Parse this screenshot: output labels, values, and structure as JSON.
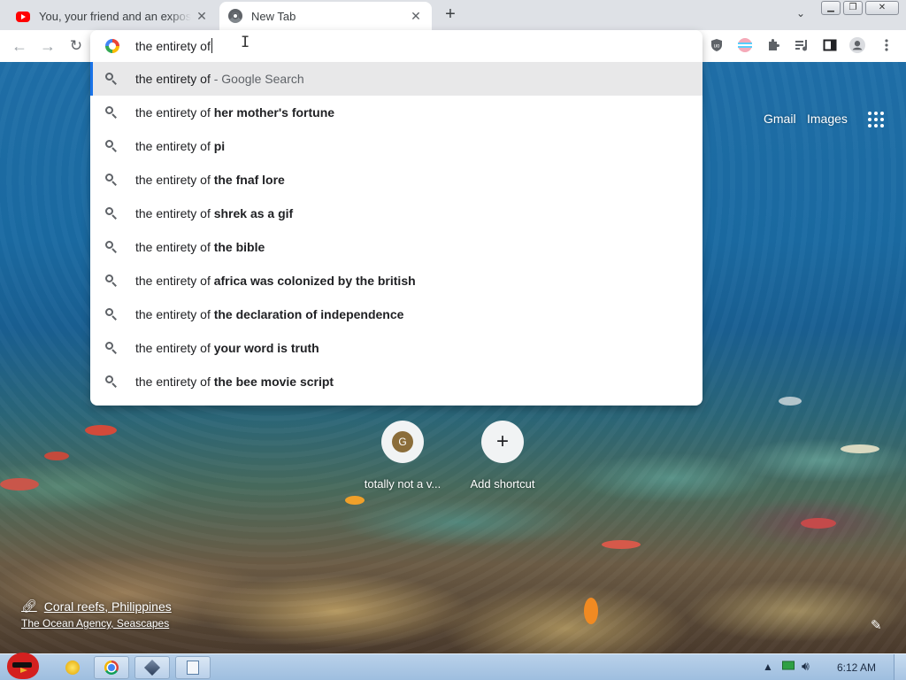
{
  "tabs": [
    {
      "title": "You, your friend and an exposed",
      "icon": "youtube-icon"
    },
    {
      "title": "New Tab",
      "icon": "chrome-icon"
    }
  ],
  "omnibox": {
    "query": "the entirety of"
  },
  "suggestions": [
    {
      "prefix": "the entirety of",
      "rest": "",
      "suffix": " - Google Search",
      "selected": true
    },
    {
      "prefix": "the entirety of ",
      "rest": "her mother's fortune",
      "suffix": ""
    },
    {
      "prefix": "the entirety of ",
      "rest": "pi",
      "suffix": ""
    },
    {
      "prefix": "the entirety of ",
      "rest": "the fnaf lore",
      "suffix": ""
    },
    {
      "prefix": "the entirety of ",
      "rest": "shrek as a gif",
      "suffix": ""
    },
    {
      "prefix": "the entirety of ",
      "rest": "the bible",
      "suffix": ""
    },
    {
      "prefix": "the entirety of ",
      "rest": "africa was colonized by the british",
      "suffix": ""
    },
    {
      "prefix": "the entirety of ",
      "rest": "the declaration of independence",
      "suffix": ""
    },
    {
      "prefix": "the entirety of ",
      "rest": "your word is truth",
      "suffix": ""
    },
    {
      "prefix": "the entirety of ",
      "rest": "the bee movie script",
      "suffix": ""
    }
  ],
  "ntp": {
    "gmail": "Gmail",
    "images": "Images",
    "shortcuts": [
      {
        "letter": "G",
        "label": "totally not a v..."
      },
      {
        "symbol": "+",
        "label": "Add shortcut"
      }
    ],
    "attribution": {
      "title": "Coral reefs, Philippines",
      "credit": "The Ocean Agency, Seascapes"
    }
  },
  "taskbar": {
    "clock": "6:12 AM"
  },
  "colors": {
    "accent": "#1a73e8",
    "tab_strip": "#dee1e6",
    "selected_suggestion": "#e8e8e9"
  }
}
